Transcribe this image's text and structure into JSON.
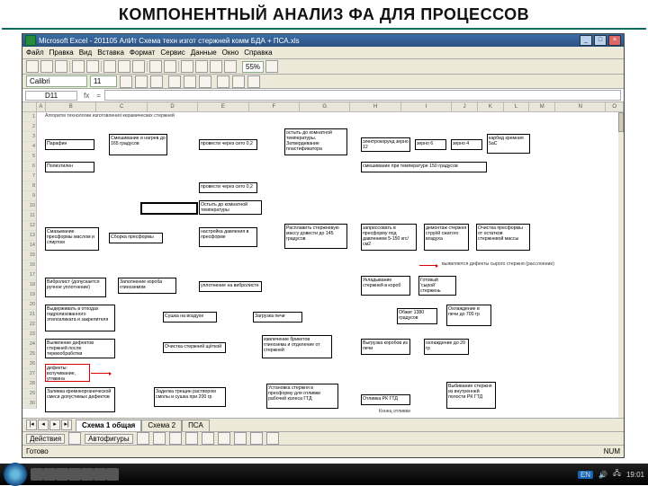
{
  "slide_title": "КОМПОНЕНТНЫЙ АНАЛИЗ ФА ДЛЯ ПРОЦЕССОВ",
  "window": {
    "app": "Microsoft Excel",
    "doc": "201105 АлИт Схема техн изгот стержней комм БДА + ПСА.xls",
    "minimize": "_",
    "maximize": "□",
    "close": "×"
  },
  "menu": [
    "Файл",
    "Правка",
    "Вид",
    "Вставка",
    "Формат",
    "Сервис",
    "Данные",
    "Окно",
    "Справка"
  ],
  "zoom": "55%",
  "font": {
    "name": "Calibri",
    "size": "11"
  },
  "name_box": "D11",
  "formula": "=",
  "title_row": "Алгоритм технологии изготовления керамических стержней",
  "boxes": {
    "r4a": "Парафин",
    "r4b": "Смешивание и нагрев до 165 градусов",
    "r4c": "провести через сито 0,2",
    "r4d": "остыть до комнатной температуры. Затвердевание пластификатора",
    "r4e": "электрокорунд зерно 12",
    "r4f": "зерно 6",
    "r4g": "зерно 4",
    "r4h": "карбид кремния 5аС",
    "r6a": "Полиэтилен",
    "r6d": "смешивание при температуре 150 градусов",
    "r8c": "провести через сито 0,2",
    "r10c": "Остыть до комнатной температуры",
    "r12a": "Смазывание пресформы маслом и спиртом",
    "r12b": "Сборка пресформы",
    "r12c": "настройка давления в пресформе",
    "r12d": "Расплавить стержневую массу довести до 145 градусов",
    "r12e": "запрессовать в пресформу под давлением 5-150 кгс/см2",
    "r12f": "демонтаж стержня струёй сжатого воздуха",
    "r12g": "Очистка пресформы от остатков стержневой массы",
    "r16note": "выявляются дефекты сырого стержня (расслоение)",
    "r18a": "Вибролист (допускается ручное уплотнение)",
    "r18b": "Заполнение короба глиноземом",
    "r18c": "уплотнение на вибролисте",
    "r18d": "Укладывание стержней в короб",
    "r18e": "Готовый 'сырой' стержень",
    "r20a": "Выдерживать в отходах гидролизованного этилсиликата и закрепителя",
    "r20b": "Сушка на воздухе",
    "r20c": "Загрузка печи",
    "r20d": "Обжиг 1380 градусов",
    "r20e": "Охлаждение в печи до 700 гр",
    "r22a": "Выявление дефектов стержней после термообработки",
    "r22b": "Очистка стержней щёткой",
    "r22c": "извлечение брикетов глинозема и отделение от стержней",
    "r22d": "Выгрузка коробов из печи",
    "r22e": "охлаждение до 20 гр",
    "r24a": "дефекты: вспучивание, утяжина",
    "r26a": "Заливка кремнеорганической смеси допустимых дефектов",
    "r26b": "Заделка трещин раствором смолы и сушка при 200 гр",
    "r26c": "Установка стержня в пресформу для отливки рабочей колеса ГТД",
    "r26d": "Отливка РК ГТД",
    "r26e": "Выбивание стержня из внутренней полости РК ГТД",
    "r28": "Конец отливки"
  },
  "sheets": {
    "active": "Схема 1 общая",
    "s2": "Схема 2",
    "s3": "ПСА"
  },
  "actions_label": "Действия",
  "autoshapes": "Автофигуры",
  "status": {
    "ready": "Готово",
    "num": "NUM"
  },
  "tray": {
    "lang": "EN",
    "time": "19:01"
  }
}
